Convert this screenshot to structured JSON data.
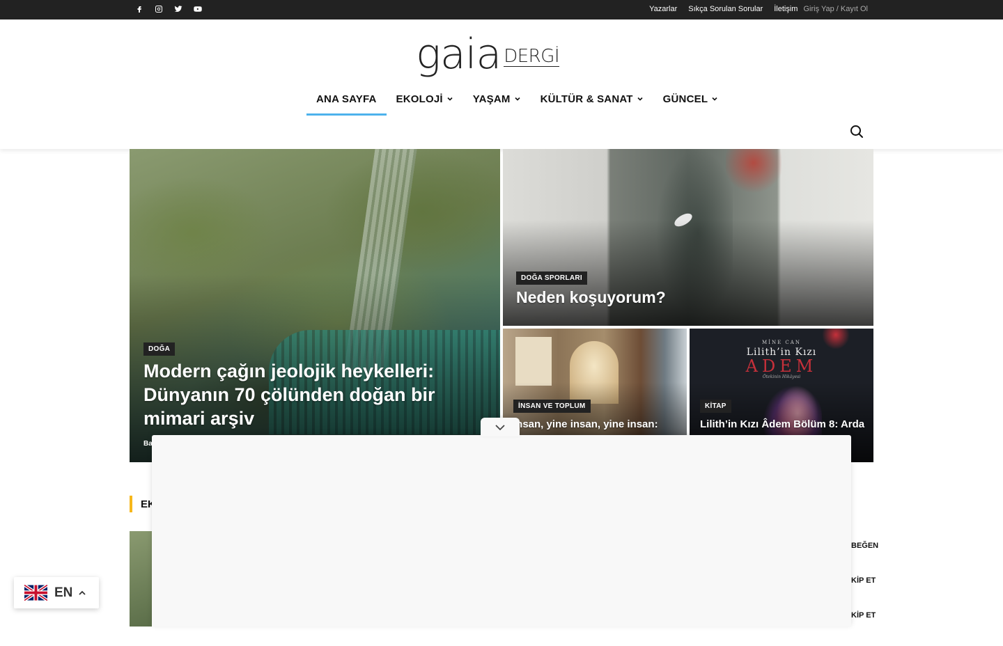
{
  "topbar": {
    "social": [
      "facebook-icon",
      "instagram-icon",
      "twitter-icon",
      "youtube-icon"
    ],
    "links": {
      "writers": "Yazarlar",
      "faq": "Sıkça Sorulan Sorular",
      "contact": "İletişim",
      "login": "Giriş Yap / Kayıt Ol"
    }
  },
  "logo": {
    "main": "gaia",
    "sub": "DERGİ"
  },
  "nav": {
    "items": [
      {
        "label": "ANA SAYFA",
        "active": true
      },
      {
        "label": "EKOLOJİ",
        "dropdown": true
      },
      {
        "label": "YAŞAM",
        "dropdown": true
      },
      {
        "label": "KÜLTÜR & SANAT",
        "dropdown": true
      },
      {
        "label": "GÜNCEL",
        "dropdown": true
      }
    ],
    "accent": "#4db2ec"
  },
  "hero": {
    "main": {
      "category": "DOĞA",
      "title": "Modern çağın jeolojik heykelleri: Dünyanın 70 çölünden doğan bir mimari arşiv",
      "author_fragment": "Ba"
    },
    "top_right": {
      "category": "DOĞA SPORLARI",
      "title": "Neden koşuyorum?"
    },
    "bottom_left": {
      "category": "İNSAN VE TOPLUM",
      "title": "İnsan, yine insan, yine insan:"
    },
    "bottom_right": {
      "category": "KİTAP",
      "title": "Lilith’in Kızı Âdem Bölüm 8: Arda",
      "cover": {
        "author": "MİNE CAN",
        "book_title": "Lilith’in Kızı",
        "name": "ADEM",
        "subtitle": "Ötekinin Hikâyesi"
      }
    }
  },
  "section": {
    "title_fragment": "EK",
    "accent": "#f6b71b",
    "side_fragments": [
      "BEĞEN",
      "KİP ET",
      "KİP ET"
    ]
  },
  "language": {
    "code": "EN"
  }
}
